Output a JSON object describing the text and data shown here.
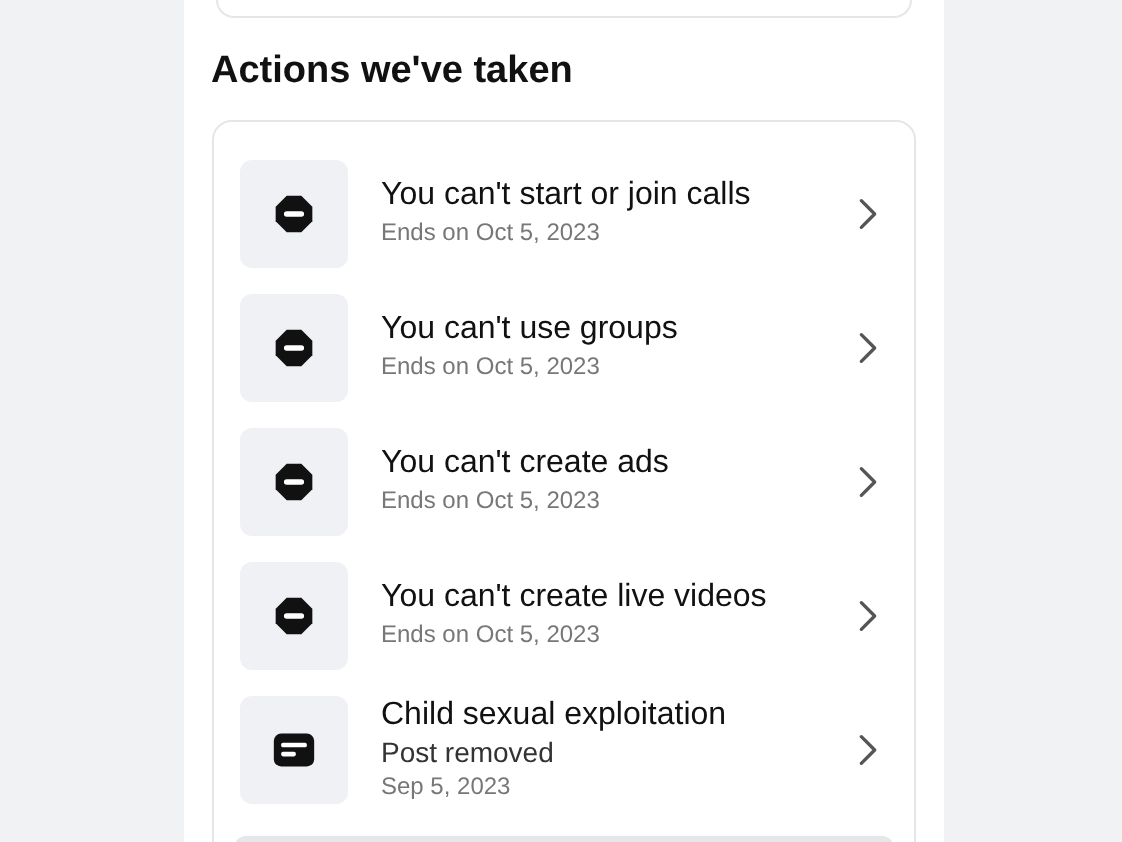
{
  "heading": "Actions we've taken",
  "actions": [
    {
      "kind": "restriction",
      "title": "You can't start or join calls",
      "lines": [
        "Ends on Oct 5, 2023"
      ]
    },
    {
      "kind": "restriction",
      "title": "You can't use groups",
      "lines": [
        "Ends on Oct 5, 2023"
      ]
    },
    {
      "kind": "restriction",
      "title": "You can't create ads",
      "lines": [
        "Ends on Oct 5, 2023"
      ]
    },
    {
      "kind": "restriction",
      "title": "You can't create live videos",
      "lines": [
        "Ends on Oct 5, 2023"
      ]
    },
    {
      "kind": "post",
      "title": "Child sexual exploitation",
      "lines": [
        "Post removed",
        "Sep 5, 2023"
      ]
    }
  ]
}
